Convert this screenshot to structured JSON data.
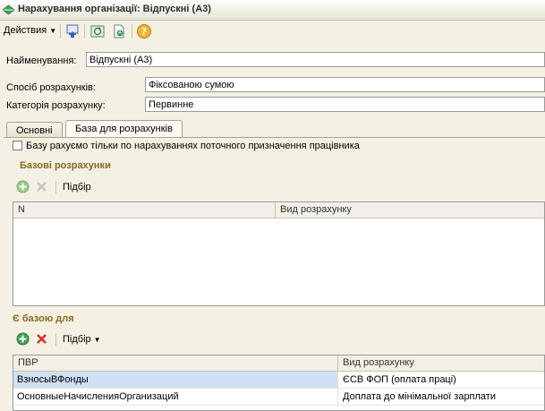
{
  "window": {
    "title": "Нарахування організації: Відпускні (А3)"
  },
  "toolbar": {
    "actions_label": "Действия"
  },
  "form": {
    "name_label": "Найменування:",
    "name_value": "Відпускні (А3)",
    "method_label": "Спосіб розрахунків:",
    "method_value": "Фіксованою сумою",
    "category_label": "Категорія розрахунку:",
    "category_value": "Первинне"
  },
  "tabs": [
    {
      "label": "Основні"
    },
    {
      "label": "База для розрахунків"
    }
  ],
  "base_checkbox_label": "Базу рахуємо тільки по нарахуваннях поточного призначення працівника",
  "base_section": {
    "title": "Базові розрахунки",
    "pick_label": "Підбір",
    "columns": [
      "N",
      "Вид розрахунку"
    ],
    "rows": []
  },
  "is_base_section": {
    "title": "Є базою для",
    "pick_label": "Підбір",
    "columns": [
      "ПВР",
      "Вид розрахунку"
    ],
    "rows": [
      [
        "ВзносыВФонды",
        "ЄСВ ФОП (оплата праці)"
      ],
      [
        "ОсновныеНачисленияОрганизаций",
        "Доплата до мінімальної зарплати"
      ]
    ]
  },
  "colors": {
    "accent_title": "#8a6a1c",
    "selection": "#cfe0f4",
    "background": "#f4f1e4"
  }
}
